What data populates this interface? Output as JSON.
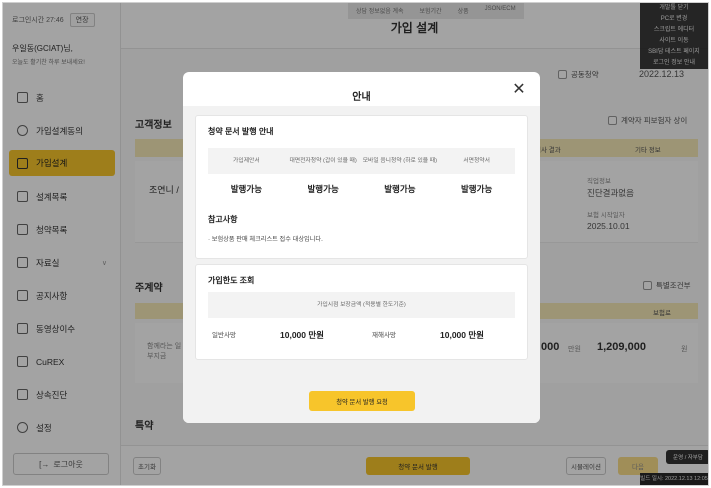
{
  "sidebar": {
    "session_time": "로그인시간 27:46",
    "extend_label": "연장",
    "user_name": "우일동(GCIAT)님,",
    "user_greeting": "오늘도 활기찬 하루 보내세요!",
    "items": [
      {
        "label": "홈",
        "icon": "home-icon"
      },
      {
        "label": "가입설계동의",
        "icon": "person-icon"
      },
      {
        "label": "가입설계",
        "icon": "edit-icon"
      },
      {
        "label": "설계목록",
        "icon": "list-icon"
      },
      {
        "label": "청약목록",
        "icon": "document-icon"
      },
      {
        "label": "자료실",
        "icon": "folder-icon"
      },
      {
        "label": "공지사항",
        "icon": "megaphone-icon"
      },
      {
        "label": "동영상이수",
        "icon": "video-icon"
      },
      {
        "label": "CuREX",
        "icon": "calculator-icon"
      },
      {
        "label": "상속진단",
        "icon": "chart-icon"
      },
      {
        "label": "설정",
        "icon": "gear-icon"
      }
    ],
    "logout_label": "로그아웃"
  },
  "header": {
    "title": "가입 설계",
    "joint_label": "공동청약",
    "date": "2022.12.13"
  },
  "dev": {
    "top_items": [
      "상담 정보없음 계속",
      "보험기간",
      "상품",
      "JSON/ECM"
    ],
    "menu": [
      "개발툴 닫기",
      "PC로 변경",
      "스크립트 에디터",
      "사이트 이동",
      "SBI답 테스트 페이지",
      "로그인 정보 안내"
    ],
    "status": "빌드 일시: 2022.12.13 12:05"
  },
  "background": {
    "customer_section": "고객정보",
    "not_insured_label": "계약자 피보험자 상이",
    "col_result": "심사 결과",
    "col_other": "기타 정보",
    "customer_name": "조연니 /",
    "job_label": "직업정보",
    "job_value": "진단결과없음",
    "date_label": "보험 시작일자",
    "date_value": "2025.10.01",
    "main_contract": "주계약",
    "special_label": "특별조건부",
    "premium_col": "보험료",
    "amount_partial": "000",
    "amount_unit": "만원",
    "premium_value": "1,209,000",
    "premium_unit": "원",
    "rider_section": "특약",
    "rider_text": "함께라는 일부지금",
    "footer_reset": "초기화",
    "footer_issue": "청약 문서 발행",
    "footer_save": "시뮬레이션",
    "footer_next": "다음",
    "footer_dark": "운영 / 자부담"
  },
  "modal": {
    "title": "안내",
    "section1_title": "청약 문서 발행 안내",
    "columns": [
      "가입제안서",
      "대면전자청약 (갑이 있을 때)",
      "모바일 음니청약 (하로 있을 때)",
      "서면청약서"
    ],
    "values": [
      "발행가능",
      "발행가능",
      "발행가능",
      "발행가능"
    ],
    "notes_title": "참고사항",
    "note": "· 보험상품 판매 체크리스트 접수 대상입니다.",
    "section2_title": "가입한도 조회",
    "limit_header": "가입시점 보장금액 (적용별 한도기준)",
    "limit_label1": "일반사망",
    "limit_value1": "10,000 만원",
    "limit_label2": "재해사망",
    "limit_value2": "10,000 만원",
    "issue_button": "청약 문서 발행 요청"
  }
}
